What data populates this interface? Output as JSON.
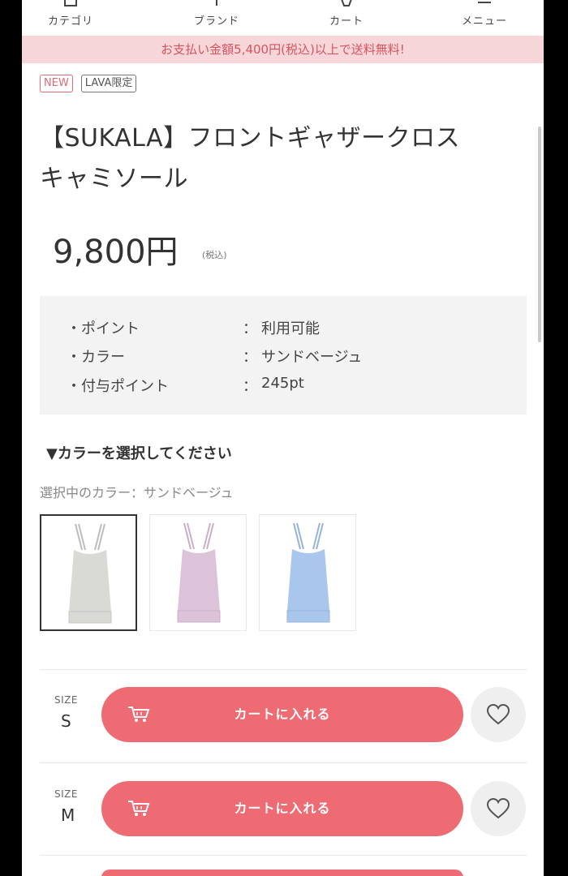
{
  "nav": {
    "items": [
      {
        "label": "カテゴリ",
        "icon": "category-icon"
      },
      {
        "label": "ブランド",
        "icon": "brand-icon"
      },
      {
        "label": "カート",
        "icon": "cart-icon"
      },
      {
        "label": "メニュー",
        "icon": "menu-icon"
      }
    ]
  },
  "banner": {
    "text": "お支払い金額5,400円(税込)以上で送料無料!"
  },
  "badges": {
    "new": "NEW",
    "limited": "LAVA限定"
  },
  "product": {
    "title_line1": "【SUKALA】フロントギャザークロス",
    "title_line2": "キャミソール",
    "price": "9,800円",
    "tax_note": "(税込)"
  },
  "info": {
    "rows": [
      {
        "key": "・ポイント",
        "sep": "：",
        "value": "利用可能"
      },
      {
        "key": "・カラー",
        "sep": "：",
        "value": "サンドベージュ"
      },
      {
        "key": "・付与ポイント",
        "sep": "：",
        "value": "245pt"
      }
    ]
  },
  "colors": {
    "heading": "▼カラーを選択してください",
    "selected_text": "選択中のカラー：サンドベージュ",
    "swatches": [
      {
        "hex": "#d9d9d6"
      },
      {
        "hex": "#dcc3d9"
      },
      {
        "hex": "#a9c6ec"
      }
    ]
  },
  "sizes": {
    "size_caption": "SIZE",
    "cart_label": "カートに入れる",
    "items": [
      {
        "size": "S"
      },
      {
        "size": "M"
      }
    ]
  },
  "theme": {
    "accent": "#ee6b73",
    "banner_bg": "#f7d6d9",
    "banner_text": "#d7545f"
  }
}
